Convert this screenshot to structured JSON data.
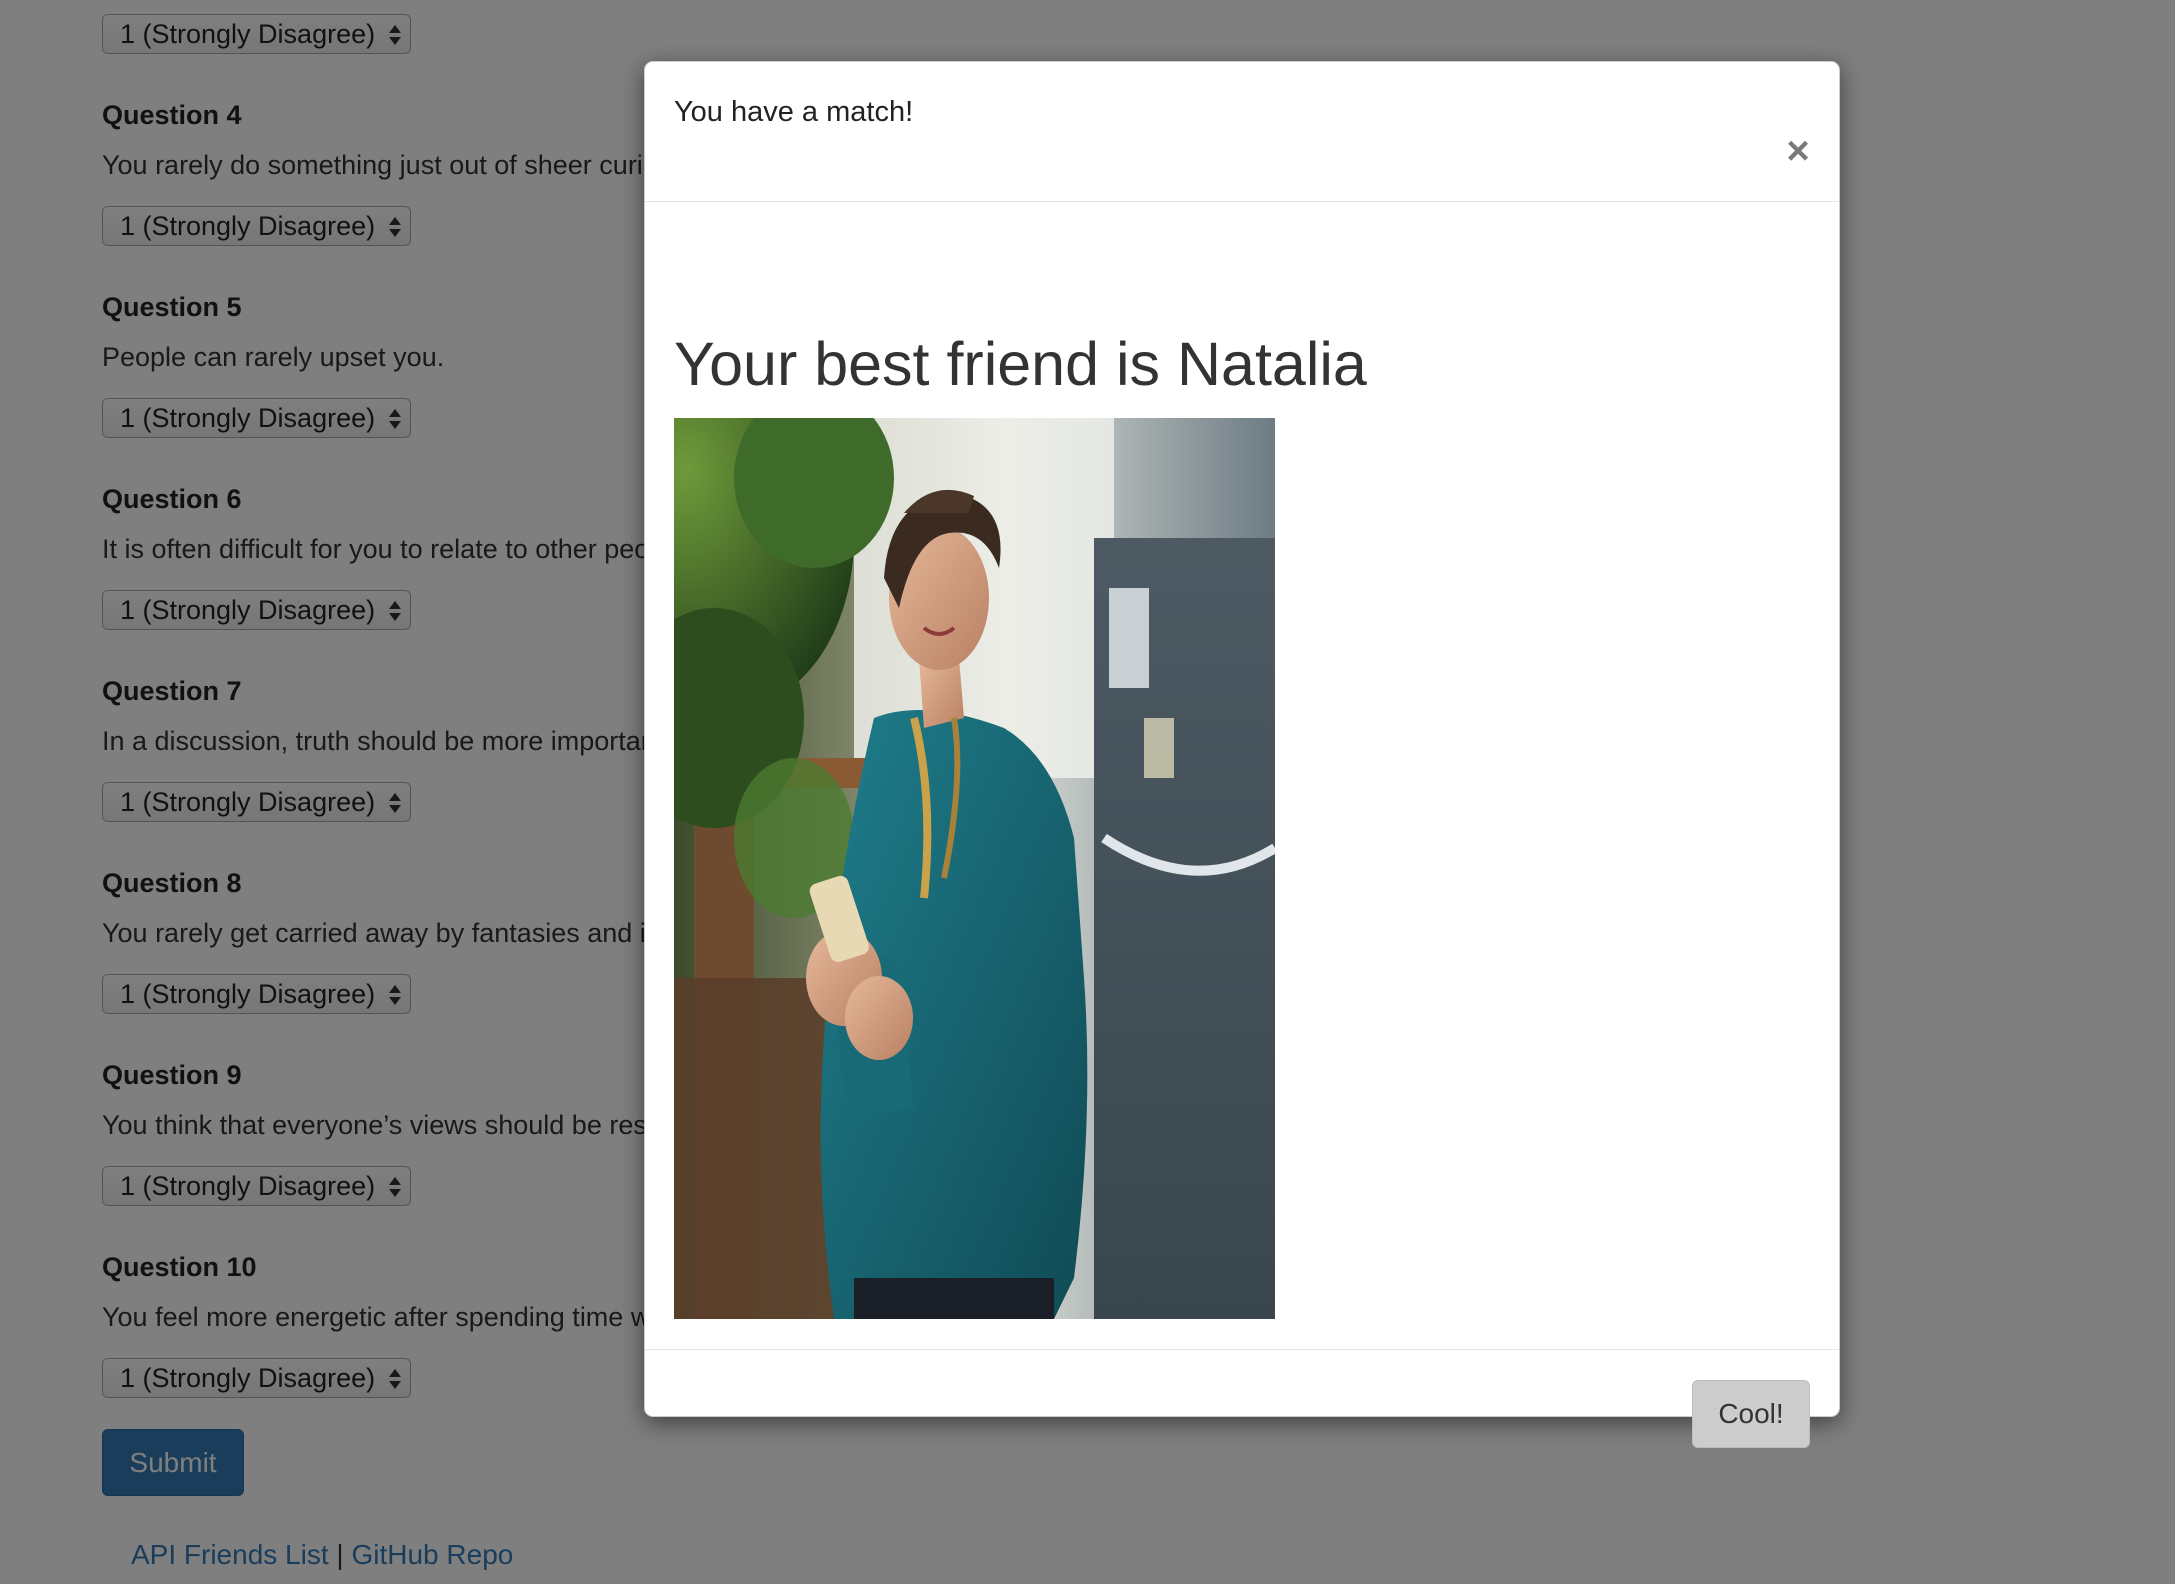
{
  "survey": {
    "select_value": "1 (Strongly Disagree)",
    "questions": [
      {
        "title": "Question 4",
        "text": "You rarely do something just out of sheer curiosity."
      },
      {
        "title": "Question 5",
        "text": "People can rarely upset you."
      },
      {
        "title": "Question 6",
        "text": "It is often difficult for you to relate to other people’s feelings."
      },
      {
        "title": "Question 7",
        "text": "In a discussion, truth should be more important than people’s sensitivities."
      },
      {
        "title": "Question 8",
        "text": "You rarely get carried away by fantasies and ideas."
      },
      {
        "title": "Question 9",
        "text": "You think that everyone’s views should be respected regardless of whether they are supported by facts or not."
      },
      {
        "title": "Question 10",
        "text": "You feel more energetic after spending time with a group of people."
      }
    ],
    "submit_label": "Submit"
  },
  "footer": {
    "link1": "API Friends List",
    "separator": "|",
    "link2": "GitHub Repo"
  },
  "modal": {
    "title": "You have a match!",
    "close_symbol": "×",
    "heading": "Your best friend is Natalia",
    "photo_alt": "photo of a smiling woman in a teal shirt holding a phone",
    "cool_label": "Cool!"
  },
  "colors": {
    "link": "#337ab7",
    "primary_button": "#337ab7",
    "backdrop": "rgba(0,0,0,0.5)"
  }
}
